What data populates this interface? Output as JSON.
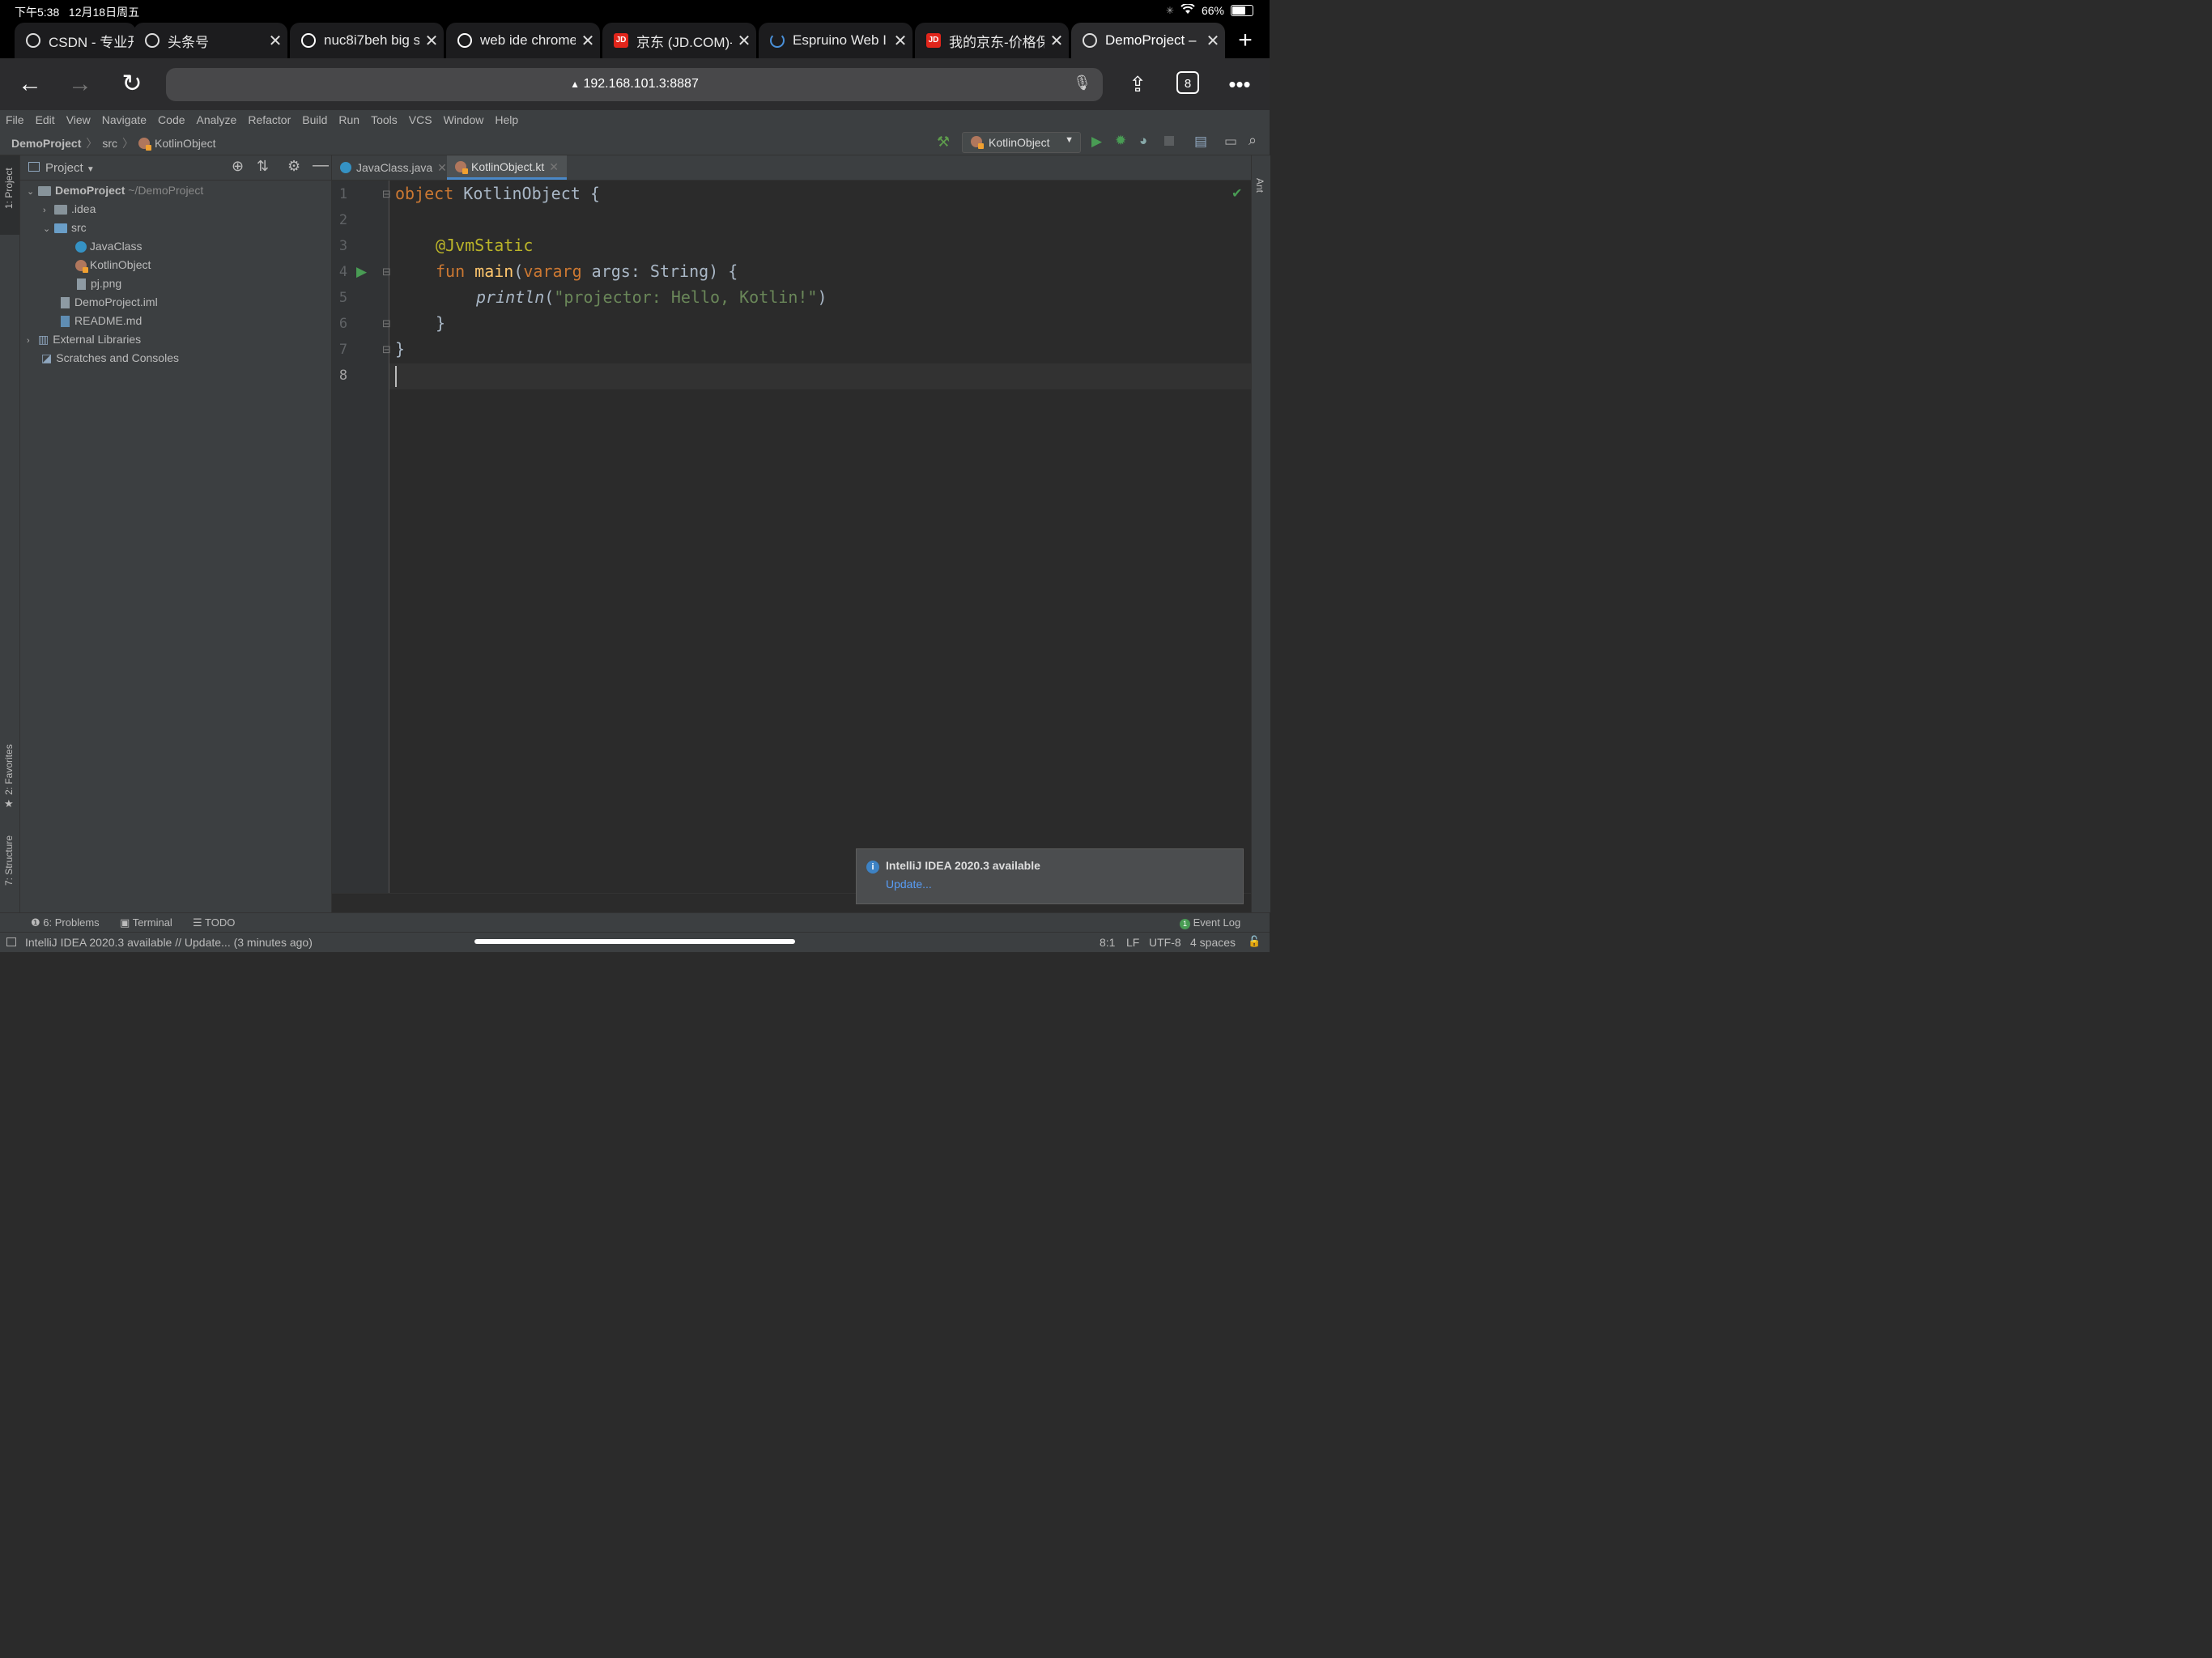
{
  "status_bar": {
    "time": "下午5:38",
    "date": "12月18日周五",
    "battery": "66%"
  },
  "browser": {
    "tabs": [
      {
        "title": "CSDN - 专业开",
        "icon": "globe-icon",
        "closable": false
      },
      {
        "title": "头条号",
        "icon": "globe-icon",
        "closable": true
      },
      {
        "title": "nuc8i7beh big s",
        "icon": "google-icon",
        "closable": true
      },
      {
        "title": "web ide chrome",
        "icon": "google-icon",
        "closable": true
      },
      {
        "title": "京东 (JD.COM)-",
        "icon": "jd-icon",
        "closable": true
      },
      {
        "title": "Espruino Web I",
        "icon": "loading-icon",
        "closable": true
      },
      {
        "title": "我的京东-价格保",
        "icon": "jd-icon",
        "closable": true
      },
      {
        "title": "DemoProject –",
        "icon": "globe-icon",
        "closable": true,
        "active": true
      }
    ],
    "url": "192.168.101.3:8887",
    "tab_count": "8",
    "jd_label": "JD"
  },
  "ide": {
    "menu": [
      "File",
      "Edit",
      "View",
      "Navigate",
      "Code",
      "Analyze",
      "Refactor",
      "Build",
      "Run",
      "Tools",
      "VCS",
      "Window",
      "Help"
    ],
    "breadcrumb": {
      "project": "DemoProject",
      "folder": "src",
      "file": "KotlinObject"
    },
    "run_config": "KotlinObject",
    "left_strip": {
      "project": "1: Project",
      "favorites": "2: Favorites",
      "structure": "7: Structure"
    },
    "right_strip": {
      "ant": "Ant"
    },
    "project_panel": {
      "title": "Project",
      "root_name": "DemoProject",
      "root_path": "~/DemoProject",
      "items": {
        "idea": ".idea",
        "src": "src",
        "java_class": "JavaClass",
        "kotlin_object": "KotlinObject",
        "pj_png": "pj.png",
        "iml": "DemoProject.iml",
        "readme": "README.md",
        "ext_libs": "External Libraries",
        "scratches": "Scratches and Consoles"
      }
    },
    "editor_tabs": [
      {
        "label": "JavaClass.java",
        "active": false
      },
      {
        "label": "KotlinObject.kt",
        "active": true
      }
    ],
    "code": {
      "l1_kw": "object",
      "l1_rest": " KotlinObject {",
      "l3_ann": "@JvmStatic",
      "l4_kw": "fun",
      "l4_fn": "main",
      "l4_p1": "(",
      "l4_kw2": "vararg",
      "l4_rest": " args: String) {",
      "l5_call": "println",
      "l5_p": "(",
      "l5_str": "\"projector: Hello, Kotlin!\"",
      "l5_end": ")",
      "l6": "}",
      "l7": "}"
    },
    "line_numbers": [
      "1",
      "2",
      "3",
      "4",
      "5",
      "6",
      "7",
      "8"
    ],
    "notification": {
      "title": "IntelliJ IDEA 2020.3 available",
      "action": "Update..."
    },
    "tool_windows": {
      "problems": "6: Problems",
      "terminal": "Terminal",
      "todo": "TODO",
      "event_log": "Event Log",
      "event_count": "1"
    },
    "status": {
      "message": "IntelliJ IDEA 2020.3 available // Update... (3 minutes ago)",
      "position": "8:1",
      "line_sep": "LF",
      "encoding": "UTF-8",
      "indent": "4 spaces"
    }
  }
}
